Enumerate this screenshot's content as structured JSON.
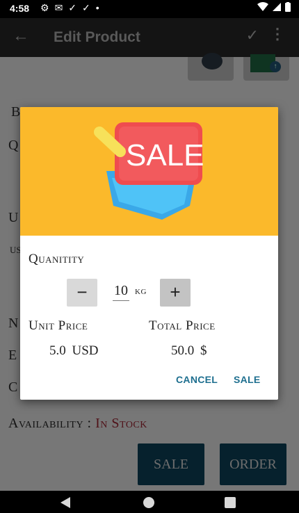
{
  "status_bar": {
    "time": "4:58",
    "dot": "•"
  },
  "app_bar": {
    "title": "Edit Product",
    "back_icon": "←",
    "check_icon": "✓",
    "more_icon": "⋮"
  },
  "background": {
    "labels": [
      "B",
      "Q",
      "U",
      "US",
      "N",
      "E",
      "C"
    ],
    "availability_label": "Availability :",
    "availability_value": "In Stock",
    "sale_button": "SALE",
    "order_button": "ORDER"
  },
  "dialog": {
    "banner_text": "SALE",
    "quantity_label": "Quanitity",
    "minus_label": "−",
    "plus_label": "+",
    "quantity_value": "10",
    "quantity_unit": "kg",
    "unit_price_label": "Unit Price",
    "total_price_label": "Total Price",
    "unit_price_value": "5.0 USD",
    "total_price_value": "50.0 $",
    "cancel_button": "CANCEL",
    "sale_button": "SALE"
  },
  "colors": {
    "header_bg": "#fbb92b",
    "accent": "#1e6f8f",
    "availability": "#8a1f2b"
  }
}
